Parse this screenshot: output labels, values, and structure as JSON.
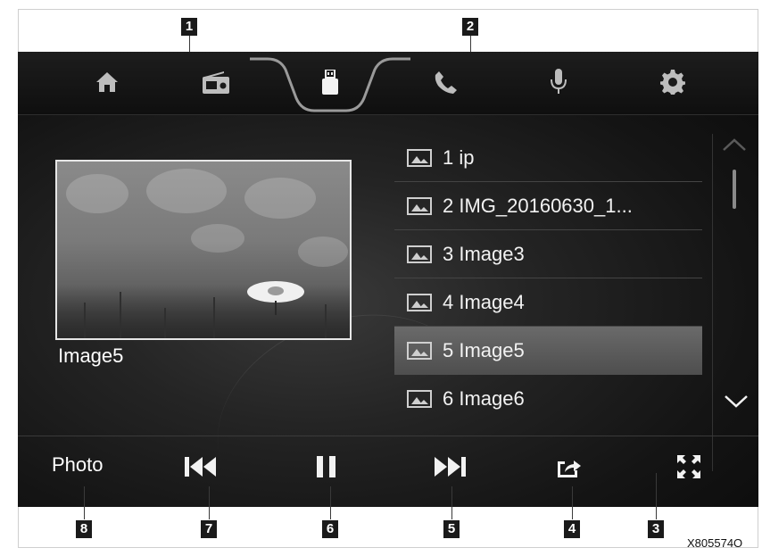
{
  "callouts": {
    "top": [
      "1",
      "2"
    ],
    "bottom": [
      "8",
      "7",
      "6",
      "5",
      "4",
      "3"
    ]
  },
  "nav_tabs": [
    {
      "icon": "home-icon"
    },
    {
      "icon": "radio-icon"
    },
    {
      "icon": "usb-icon",
      "active": true
    },
    {
      "icon": "phone-icon"
    },
    {
      "icon": "microphone-icon"
    },
    {
      "icon": "settings-gear-icon"
    }
  ],
  "preview": {
    "caption": "Image5"
  },
  "file_list": {
    "items": [
      {
        "label": "1 ip"
      },
      {
        "label": "2 IMG_20160630_1..."
      },
      {
        "label": "3 Image3"
      },
      {
        "label": "4 Image4"
      },
      {
        "label": "5 Image5",
        "selected": true
      },
      {
        "label": "6 Image6"
      }
    ]
  },
  "controls": {
    "mode_label": "Photo",
    "icons": [
      "previous-icon",
      "pause-icon",
      "next-icon",
      "share-icon",
      "fullscreen-icon"
    ]
  },
  "part_code": "X805574O",
  "colors": {
    "screen_bg": "#141414",
    "text": "#f2f2f2",
    "selected_row": "#5a5a5a"
  }
}
